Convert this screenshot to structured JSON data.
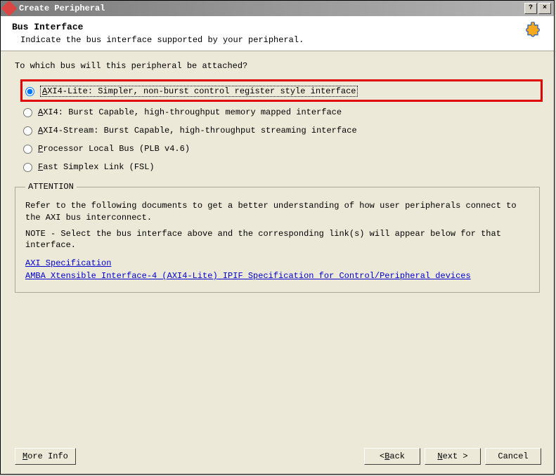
{
  "window": {
    "title": "Create Peripheral"
  },
  "header": {
    "title": "Bus Interface",
    "subtitle": "Indicate the bus interface supported by your peripheral."
  },
  "question": "To which bus will this peripheral be attached?",
  "options": {
    "axi4lite": {
      "u": "A",
      "rest": "XI4-Lite: Simpler, non-burst control register style interface"
    },
    "axi4": {
      "u": "A",
      "rest": "XI4: Burst Capable, high-throughput memory mapped interface"
    },
    "axi4s": {
      "u": "A",
      "rest": "XI4-Stream: Burst Capable, high-throughput streaming interface"
    },
    "plb": {
      "u": "P",
      "rest": "rocessor Local Bus (PLB v4.6)"
    },
    "fsl": {
      "u": "F",
      "rest": "ast Simplex Link (FSL)"
    }
  },
  "attention": {
    "legend": "ATTENTION",
    "para1": "Refer to the following documents to get a better understanding of how user peripherals connect to the AXI bus interconnect.",
    "para2": "NOTE - Select the bus interface above and the corresponding link(s) will appear below for that interface.",
    "link1": "AXI Specification",
    "link2": "AMBA Xtensible Interface-4 (AXI4-Lite) IPIF Specification for Control/Peripheral devices"
  },
  "buttons": {
    "moreinfo_u": "M",
    "moreinfo_rest": "ore Info",
    "back_pre": "< ",
    "back_u": "B",
    "back_rest": "ack",
    "next_u": "N",
    "next_rest": "ext >",
    "cancel": "Cancel"
  }
}
